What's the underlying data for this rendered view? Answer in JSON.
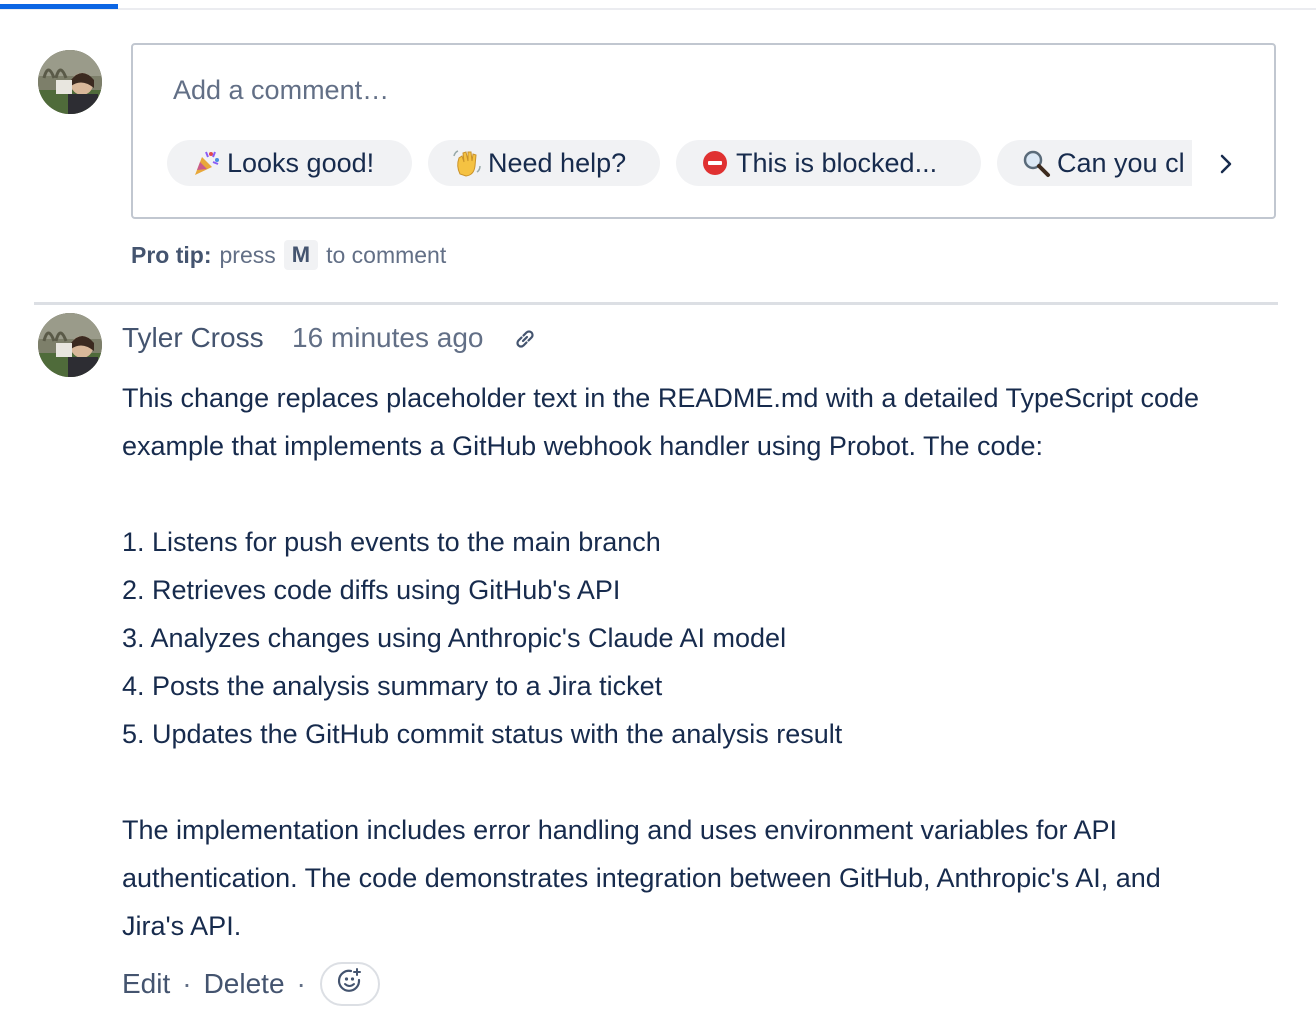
{
  "colors": {
    "accent": "#0C66E4",
    "text": "#172B4D",
    "subtle_text": "#626F86",
    "chip_bg": "#F1F2F4",
    "border": "#C1C7D0"
  },
  "editor": {
    "placeholder": "Add a comment…",
    "chips": [
      {
        "icon": "party-popper-icon",
        "label": "Looks good!"
      },
      {
        "icon": "waving-hand-icon",
        "label": "Need help?"
      },
      {
        "icon": "no-entry-icon",
        "label": "This is blocked..."
      },
      {
        "icon": "magnifier-icon",
        "label": "Can you cl"
      }
    ],
    "next_icon": "chevron-right-icon"
  },
  "pro_tip": {
    "label": "Pro tip:",
    "before": "press",
    "key": "M",
    "after": "to comment"
  },
  "comment": {
    "author": "Tyler Cross",
    "time": "16 minutes ago",
    "link_icon": "link-icon",
    "body": {
      "intro": [
        "This change replaces placeholder text in the README.md with a detailed TypeScript code",
        "example that implements a GitHub webhook handler using Probot. The code:"
      ],
      "steps": [
        "1. Listens for push events to the main branch",
        "2. Retrieves code diffs using GitHub's API",
        "3. Analyzes changes using Anthropic's Claude AI model",
        "4. Posts the analysis summary to a Jira ticket",
        "5. Updates the GitHub commit status with the analysis result"
      ],
      "outro": [
        "The implementation includes error handling and uses environment variables for API",
        "authentication. The code demonstrates integration between GitHub, Anthropic's AI, and",
        "Jira's API."
      ]
    },
    "actions": {
      "edit": "Edit",
      "delete": "Delete",
      "separator": "·",
      "reaction_icon": "emoji-add-icon"
    }
  }
}
